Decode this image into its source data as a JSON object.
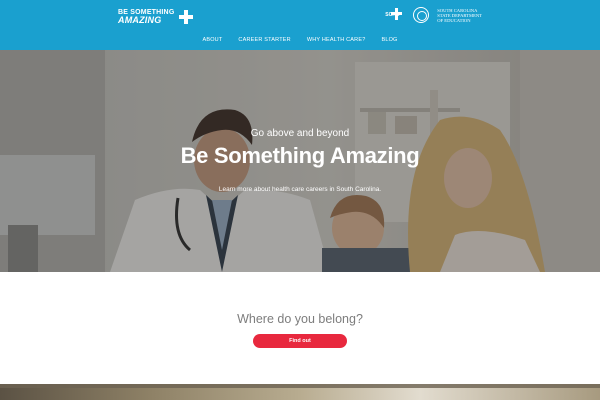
{
  "header": {
    "logo_line1": "BE SOMETHING",
    "logo_line2": "AMAZING",
    "partner_scha": "SCHA",
    "partner_sde": [
      "SOUTH CAROLINA",
      "STATE DEPARTMENT",
      "OF EDUCATION"
    ],
    "nav": [
      "ABOUT",
      "CAREER STARTER",
      "WHY HEALTH CARE?",
      "BLOG"
    ],
    "brand_color": "#1aa0cf"
  },
  "hero": {
    "subtitle": "Go above and beyond",
    "title": "Be Something Amazing",
    "text": "Learn more about health care careers in South Carolina."
  },
  "belong": {
    "question": "Where do you belong?",
    "button_label": "Find out",
    "button_color": "#e8283e"
  }
}
